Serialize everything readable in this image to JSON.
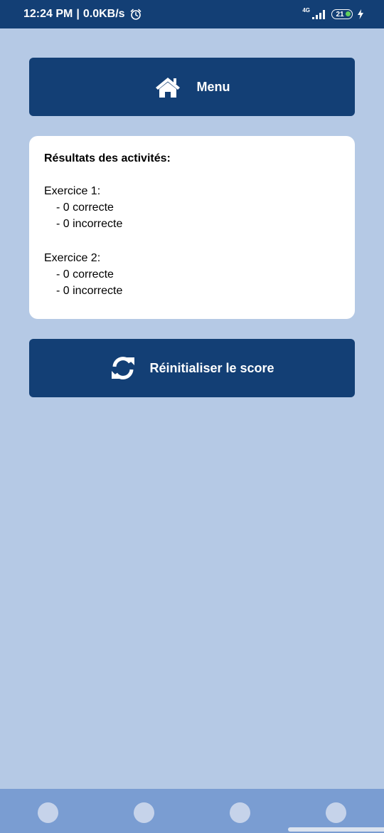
{
  "status_bar": {
    "time": "12:24 PM",
    "separator": "|",
    "speed": "0.0KB/s",
    "network": "4G",
    "battery_level": "21",
    "icons": [
      "alarm-icon",
      "signal-icon",
      "battery-icon",
      "charging-icon"
    ]
  },
  "menu_button": {
    "label": "Menu",
    "icon": "home-icon"
  },
  "results": {
    "title": "Résultats des activités:",
    "exercises": [
      {
        "title": "Exercice 1:",
        "correct": "- 0 correcte",
        "incorrect": "- 0 incorrecte"
      },
      {
        "title": "Exercice 2:",
        "correct": "- 0 correcte",
        "incorrect": "- 0 incorrecte"
      }
    ]
  },
  "reset_button": {
    "label": "Réinitialiser le score",
    "icon": "refresh-icon"
  },
  "nav_bar": {
    "items": [
      "nav-button-1",
      "nav-button-2",
      "nav-button-3",
      "nav-button-4"
    ]
  },
  "colors": {
    "background": "#b5c9e5",
    "primary": "#133f75",
    "card": "#ffffff",
    "nav_bar": "#7a9dd2",
    "nav_dot": "#c6d3ea"
  }
}
